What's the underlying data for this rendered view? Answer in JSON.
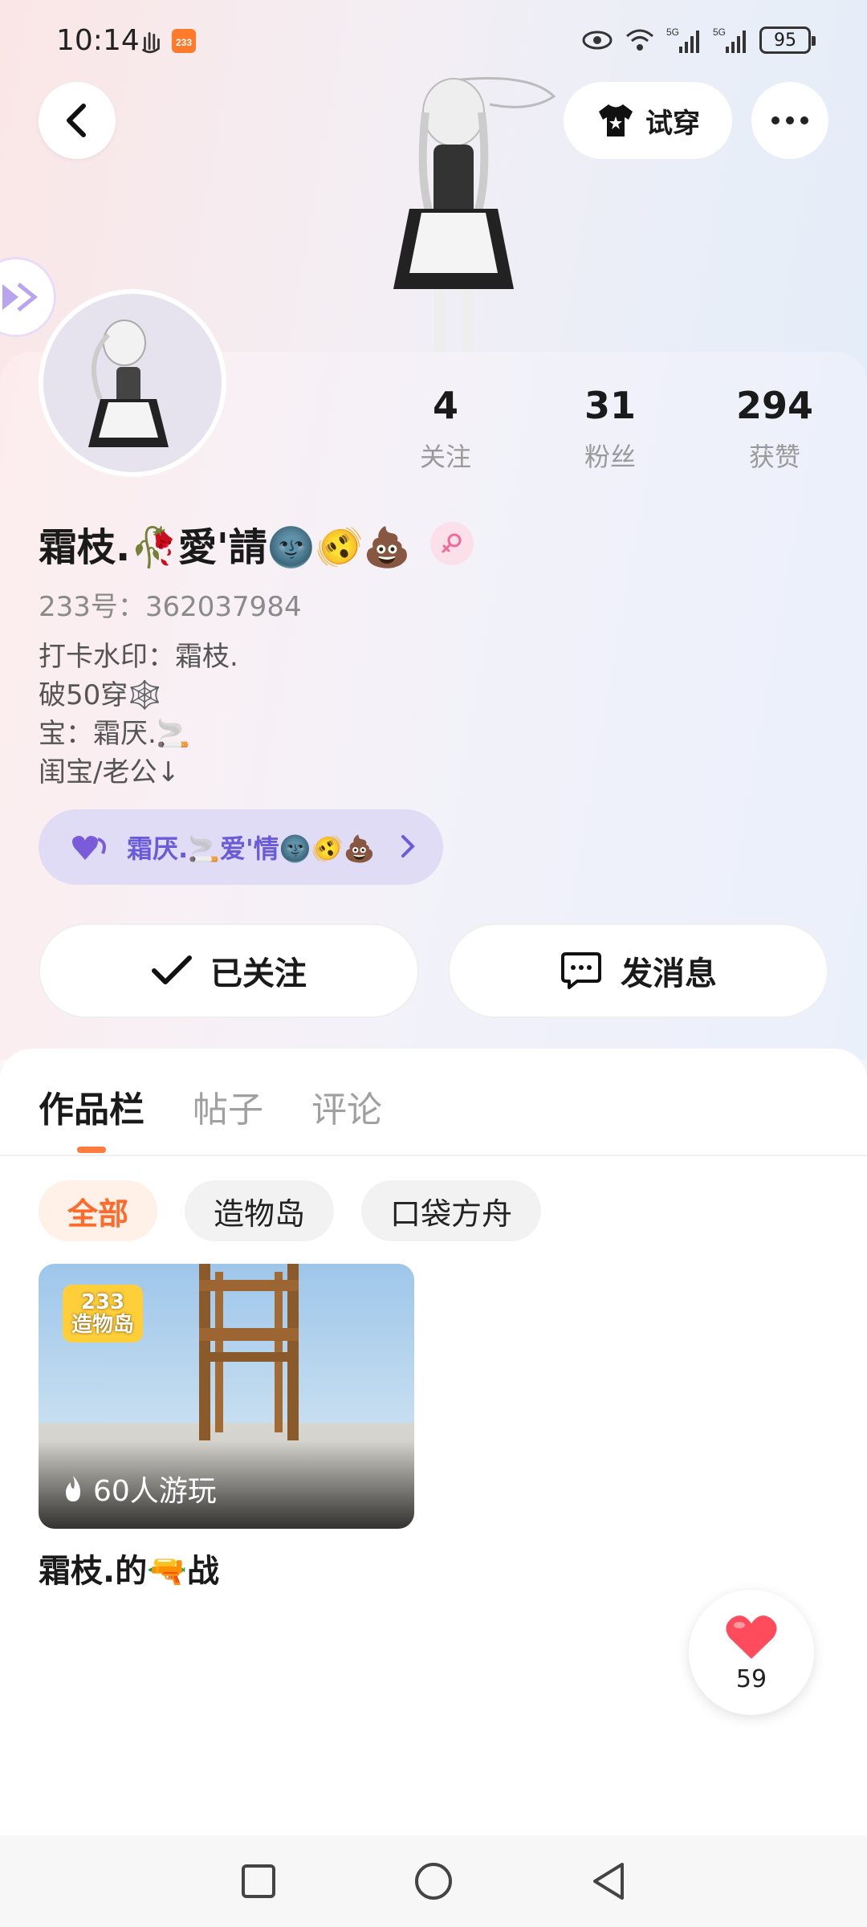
{
  "status_bar": {
    "time": "10:14",
    "battery": "95"
  },
  "header": {
    "tryon_label": "试穿"
  },
  "stats": [
    {
      "value": "4",
      "label": "关注"
    },
    {
      "value": "31",
      "label": "粉丝"
    },
    {
      "value": "294",
      "label": "获赞"
    }
  ],
  "profile": {
    "nickname": "霜枝.🥀愛'請🌚🫨💩",
    "uid": "233号：362037984",
    "bio": [
      "打卡水印：霜枝.",
      "破50穿🕸️",
      "宝：霜厌.🚬",
      "闺宝/老公↓"
    ]
  },
  "cp_pill": {
    "text": "霜厌.🚬爱'情🌚🫨💩"
  },
  "actions": {
    "followed_label": "已关注",
    "message_label": "发消息"
  },
  "tabs": [
    {
      "label": "作品栏",
      "active": true
    },
    {
      "label": "帖子",
      "active": false
    },
    {
      "label": "评论",
      "active": false
    }
  ],
  "chips": [
    {
      "label": "全部",
      "active": true
    },
    {
      "label": "造物岛",
      "active": false
    },
    {
      "label": "口袋方舟",
      "active": false
    }
  ],
  "work": {
    "badge_top": "233",
    "badge_bottom": "造物岛",
    "plays": "60人游玩",
    "title": "霜枝.的🔫战"
  },
  "like": {
    "count": "59"
  },
  "colors": {
    "accent": "#ff6a2a",
    "pill_text": "#6a5cd8",
    "like": "#ff4b5c"
  }
}
